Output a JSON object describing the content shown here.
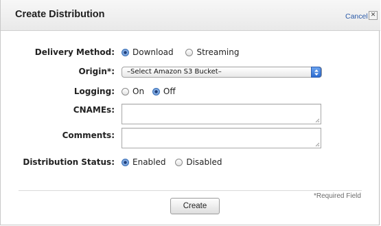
{
  "dialog": {
    "title": "Create Distribution",
    "cancel_label": "Cancel",
    "close_glyph": "✕"
  },
  "form": {
    "delivery_method": {
      "label": "Delivery Method:",
      "options": [
        "Download",
        "Streaming"
      ],
      "selected": "Download"
    },
    "origin": {
      "label": "Origin*:",
      "value": "–Select Amazon S3 Bucket–"
    },
    "logging": {
      "label": "Logging:",
      "options": [
        "On",
        "Off"
      ],
      "selected": "Off"
    },
    "cnames": {
      "label": "CNAMEs:",
      "value": ""
    },
    "comments": {
      "label": "Comments:",
      "value": ""
    },
    "distribution_status": {
      "label": "Distribution Status:",
      "options": [
        "Enabled",
        "Disabled"
      ],
      "selected": "Enabled"
    }
  },
  "footer": {
    "required_note": "*Required Field",
    "create_label": "Create"
  },
  "colors": {
    "link": "#2a5aa8",
    "select_accent": "#2c6bd0",
    "radio_selected": "#3a6fb5"
  }
}
